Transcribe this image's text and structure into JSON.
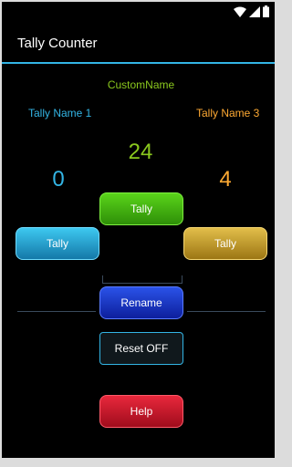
{
  "app": {
    "title": "Tally Counter"
  },
  "counter": {
    "custom_name": "CustomName",
    "tally_name_1": "Tally Name 1",
    "tally_name_3": "Tally Name 3",
    "center_count": "24",
    "left_count": "0",
    "right_count": "4"
  },
  "buttons": {
    "tally_center": "Tally",
    "tally_left": "Tally",
    "tally_right": "Tally",
    "rename": "Rename",
    "reset": "Reset OFF",
    "help": "Help"
  },
  "colors": {
    "accent": "#33b5e5",
    "custom_name": "#8ac81e",
    "tally_1": "#33b5e5",
    "tally_3": "#ffaa33"
  },
  "status_icons": [
    "wifi-icon",
    "signal-icon",
    "battery-icon"
  ]
}
